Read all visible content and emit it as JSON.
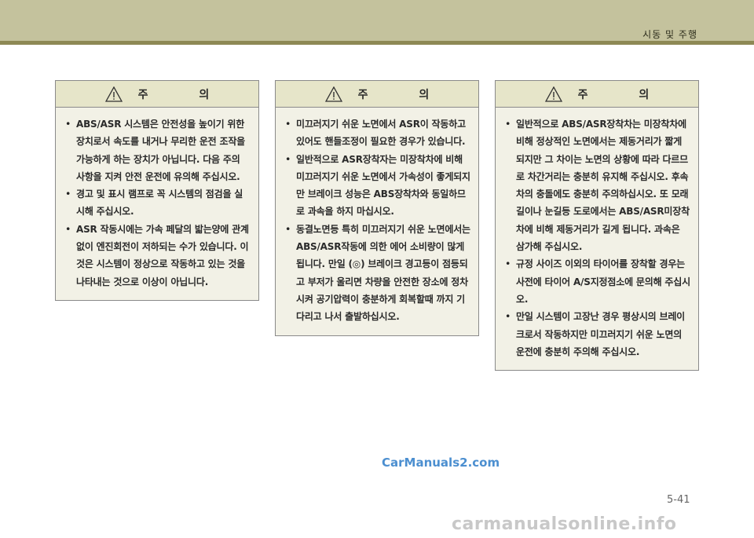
{
  "header": {
    "section_title": "시동 및 주행"
  },
  "caution_boxes": [
    {
      "title": "주 의",
      "items": [
        "ABS/ASR 시스템은 안전성을 높이기 위한 장치로서 속도를 내거나 무리한 운전 조작을 가능하게 하는 장치가 아닙니다. 다음 주의 사항을 지켜 안전 운전에 유의해 주십시오.",
        "경고 및 표시 램프로 꼭 시스템의 점검을 실시해 주십시오.",
        "ASR 작동시에는 가속 페달의 밟는양에 관계없이 엔진회전이 저하되는 수가 있습니다. 이것은 시스템이 정상으로 작동하고 있는 것을 나타내는 것으로 이상이 아닙니다."
      ]
    },
    {
      "title": "주 의",
      "items": [
        "미끄러지기 쉬운 노면에서 ASR이 작동하고 있어도 핸들조정이 필요한 경우가 있습니다.",
        "일반적으로 ASR장착자는 미장착차에 비해 미끄러지기 쉬운 노면에서 가속성이 좋게되지만 브레이크 성능은 ABS장착차와 동일하므로 과속을 하지 마십시오.",
        "동결노면등 특히 미끄러지기 쉬운 노면에서는 ABS/ASR작동에 의한 에어 소비량이 많게 됩니다. 만일 (◎) 브레이크 경고등이 점등되고 부저가 울리면 차량을 안전한 장소에 정차시켜 공기압력이 충분하게 회복할때 까지 기다리고 나서 출발하십시오."
      ]
    },
    {
      "title": "주 의",
      "items": [
        "일반적으로 ABS/ASR장착차는 미장착차에 비해 정상적인 노면에서는 제동거리가 짧게 되지만 그 차이는 노면의 상황에 따라 다르므로 차간거리는 충분히 유지해 주십시오. 후속차의 충돌에도 충분히 주의하십시오. 또 모래길이나 눈길등 도로에서는 ABS/ASR미장착차에 비해 제동거리가 길게 됩니다. 과속은 삼가해 주십시오.",
        "규정 사이즈 이외의 타이어를 장착할 경우는 사전에 타이어 A/S지정점소에 문의해 주십시오.",
        "만일 시스템이 고장난 경우 평상시의 브레이크로서 작동하지만 미끄러지기 쉬운 노면의 운전에 충분히 주의해 주십시오."
      ]
    }
  ],
  "watermark_center": "CarManuals2.com",
  "watermark_bottom": "carmanualsonline.info",
  "page_number": "5-41"
}
